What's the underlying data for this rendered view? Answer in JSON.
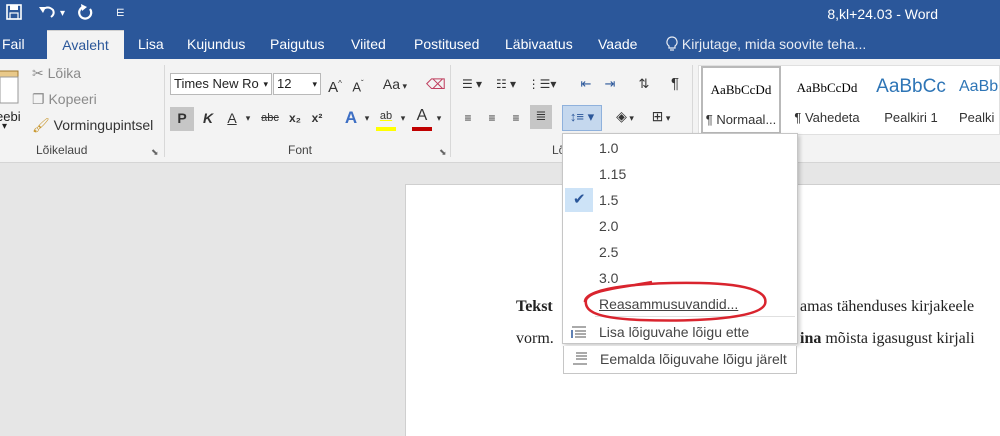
{
  "window": {
    "title": "8,kl+24.03 - Word",
    "quick_access": [
      "save-icon",
      "undo-icon",
      "redo-icon",
      "customize-icon"
    ]
  },
  "tabs": [
    {
      "label": "Fail",
      "active": false
    },
    {
      "label": "Avaleht",
      "active": true
    },
    {
      "label": "Lisa",
      "active": false
    },
    {
      "label": "Kujundus",
      "active": false
    },
    {
      "label": "Paigutus",
      "active": false
    },
    {
      "label": "Viited",
      "active": false
    },
    {
      "label": "Postitused",
      "active": false
    },
    {
      "label": "Läbivaatus",
      "active": false
    },
    {
      "label": "Vaade",
      "active": false
    }
  ],
  "tell_me": "Kirjutage, mida soovite teha...",
  "clipboard": {
    "paste_label": "eebi",
    "cut_label": "Lõika",
    "copy_label": "Kopeeri",
    "format_painter_label": "Vormingupintsel",
    "group_label": "Lõikelaud"
  },
  "font": {
    "font_name": "Times New Ro",
    "font_size": "12",
    "bold": "P",
    "italic": "K",
    "underline": "A",
    "strike": "abc",
    "subscript": "x₂",
    "superscript": "x²",
    "grow": "A",
    "shrink": "A",
    "case": "Aa",
    "effects": "A",
    "highlight": "ab",
    "color": "A",
    "group_label": "Font",
    "highlight_color": "#ffff00",
    "font_color_bar": "#c00000"
  },
  "paragraph": {
    "group_label_fragment": "Lõ"
  },
  "styles": [
    {
      "preview": "AaBbCcDd",
      "name": "¶ Normaal...",
      "selected": true
    },
    {
      "preview": "AaBbCcDd",
      "name": "¶ Vahedeta",
      "selected": false
    },
    {
      "preview": "AaBbCc",
      "name": "Pealkiri 1",
      "selected": false
    },
    {
      "preview": "AaBbC",
      "name": "Pealki",
      "selected": false
    }
  ],
  "line_spacing_menu": {
    "options": [
      "1.0",
      "1.15",
      "1.5",
      "2.0",
      "2.5",
      "3.0"
    ],
    "checked": "1.5",
    "options_link": "Reasammusuvandid...",
    "add_space_before": "Lisa lõiguvahe lõigu ette",
    "remove_space_after": "Eemalda lõiguvahe lõigu järelt"
  },
  "document": {
    "line1_bold": "Tekst",
    "line1_rest": "amas tähenduses kirjakeele",
    "line2_start": "vorm.",
    "line2_bold": "ina",
    "line2_rest": " mõista igasugust kirjali"
  },
  "colors": {
    "brand": "#2b579a",
    "annotation": "#d9242e"
  }
}
